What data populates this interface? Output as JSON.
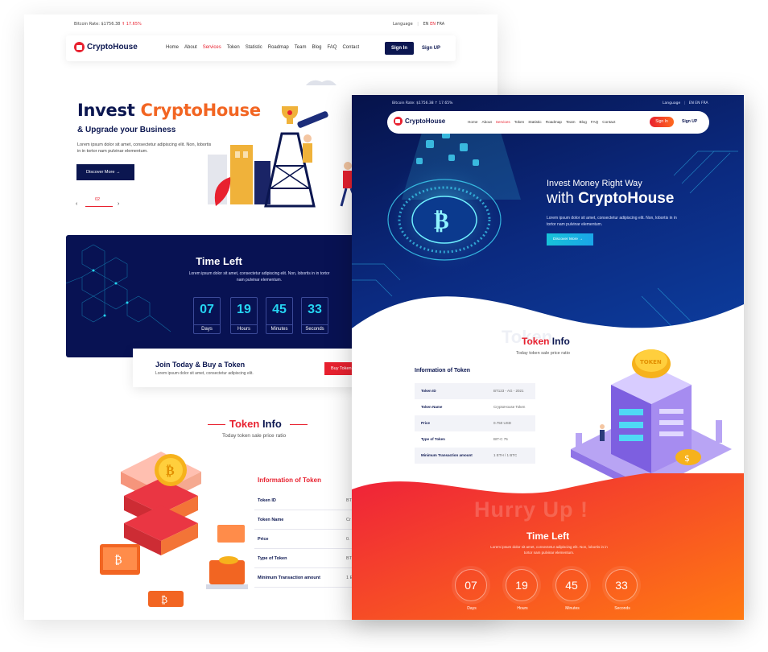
{
  "back_page": {
    "topbar": {
      "rate_label": "Bitcoin Rate: $1756.38",
      "rate_arrow": "↑",
      "rate_change": "17.65%",
      "language_label": "Language",
      "langs": [
        "EN",
        "EN",
        "FRA"
      ]
    },
    "nav": {
      "brand": "CryptoHouse",
      "items": [
        "Home",
        "About",
        "Services",
        "Token",
        "Statistic",
        "Roadmap",
        "Team",
        "Blog",
        "FAQ",
        "Contact"
      ],
      "active": "Services",
      "signin": "Sign In",
      "signup": "Sign UP"
    },
    "hero": {
      "title_prefix": "Invest ",
      "title_brand": "CryptoHouse",
      "subtitle": "& Upgrade your Business",
      "text": "Lorem ipsum dolor sit amet, consectetur adipiscing elit. Non, lobortis in in tortor  nam pulvinar elementum.",
      "button": "Discover More  →",
      "slide_num": "02",
      "prev": "‹",
      "next": "›"
    },
    "timer": {
      "title": "Time Left",
      "text": "Lorem ipsum dolor sit amet, consectetur adipiscing elit. Non, lobortis in in tortor  nam pulvinar elementum.",
      "units": [
        {
          "value": "07",
          "label": "Days"
        },
        {
          "value": "19",
          "label": "Hours"
        },
        {
          "value": "45",
          "label": "Minutes"
        },
        {
          "value": "33",
          "label": "Seconds"
        }
      ]
    },
    "join": {
      "title": "Join Today & Buy a Token",
      "text": "Lorem ipsum dolor sit amet, consectetur adipiscing elit.",
      "button": "Buy Token"
    },
    "token_info": {
      "title_a": "Token",
      "title_b": " Info",
      "subtitle": "Today token sale price ratio",
      "info_title": "Information of Token",
      "rows": [
        {
          "label": "Token ID",
          "value": "BT"
        },
        {
          "label": "Token Name",
          "value": "Cr"
        },
        {
          "label": "Price",
          "value": "0."
        },
        {
          "label": "Type of Token",
          "value": "BT"
        },
        {
          "label": "Minimum Transaction amount",
          "value": "1 E"
        }
      ]
    }
  },
  "front_page": {
    "topbar": {
      "rate_label": "Bitcoin Rate: $1756.38",
      "rate_arrow": "↑",
      "rate_change": "17.65%",
      "language_label": "Language",
      "langs": [
        "EN",
        "EN",
        "FRA"
      ]
    },
    "nav": {
      "brand": "CryptoHouse",
      "items": [
        "Home",
        "About",
        "Services",
        "Token",
        "Statistic",
        "Roadmap",
        "Team",
        "Blog",
        "FAQ",
        "Contact"
      ],
      "active": "Services",
      "signin": "Sign In",
      "signup": "Sign UP"
    },
    "hero": {
      "line1": "Invest Money Right Way",
      "line2_prefix": "with ",
      "line2_brand": "CryptoHouse",
      "text": "Lorem ipsum dolor sit amet, consectetur adipiscing elit. Non, lobortis in in tortor  nam pulvinar elementum.",
      "button": "Discover More  →"
    },
    "token_info": {
      "watermark": "Token",
      "title_a": "Token",
      "title_b": " Info",
      "subtitle": "Today token sale price ratio",
      "info_title": "Information of Token",
      "rows": [
        {
          "label": "Token ID",
          "value": "BT123 - AG - 2021"
        },
        {
          "label": "Token Name",
          "value": "CryptoHouse Token"
        },
        {
          "label": "Price",
          "value": "0.750 USD"
        },
        {
          "label": "Type of Token",
          "value": "BIT-C 75"
        },
        {
          "label": "Minimum Transaction amount",
          "value": "1 ETH / 1 BTC"
        }
      ],
      "coin_label": "TOKEN"
    },
    "timer": {
      "watermark": "Hurry Up !",
      "title": "Time Left",
      "text": "Lorem ipsum dolor sit amet, consectetur adipiscing elit. Non, lobortis in in tortor  nam pulvinar elementum.",
      "units": [
        {
          "value": "07",
          "label": "Days"
        },
        {
          "value": "19",
          "label": "Hours"
        },
        {
          "value": "45",
          "label": "Minutes"
        },
        {
          "value": "33",
          "label": "Seconds"
        }
      ]
    }
  },
  "colors": {
    "navy": "#0b1650",
    "red": "#e8212f",
    "orange": "#f26522",
    "cyan": "#25d5f2"
  }
}
